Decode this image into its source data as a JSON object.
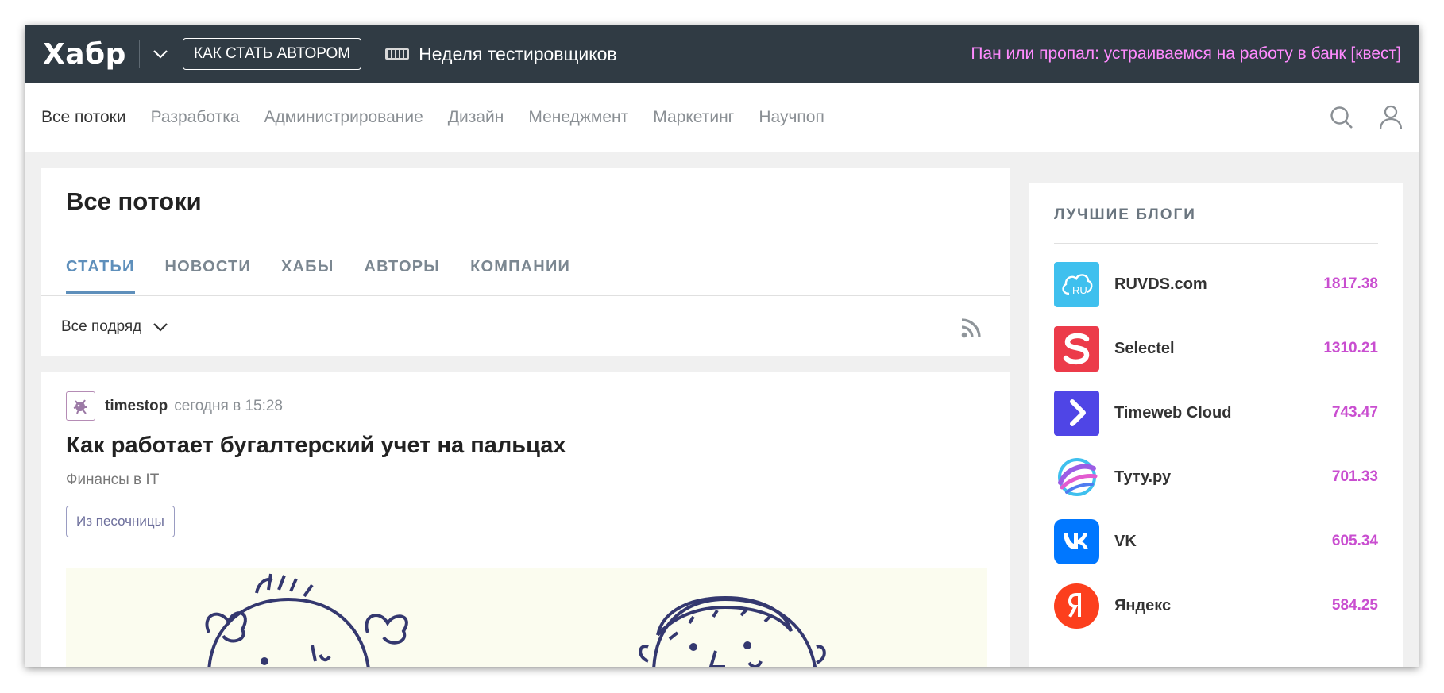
{
  "topbar": {
    "logo": "Хабр",
    "author_button": "КАК СТАТЬ АВТОРОМ",
    "promo": "Неделя тестировщиков",
    "quest_link": "Пан или пропал: устраиваемся на работу в банк [квест]"
  },
  "nav": {
    "items": [
      "Все потоки",
      "Разработка",
      "Администрирование",
      "Дизайн",
      "Менеджмент",
      "Маркетинг",
      "Научпоп"
    ],
    "active": "Все потоки",
    "icons": [
      "search-icon",
      "user-icon"
    ]
  },
  "feed": {
    "title": "Все потоки",
    "tabs": [
      "СТАТЬИ",
      "НОВОСТИ",
      "ХАБЫ",
      "АВТОРЫ",
      "КОМПАНИИ"
    ],
    "active_tab": "СТАТЬИ",
    "filter": "Все подряд"
  },
  "article": {
    "author": "timestop",
    "time": "сегодня в 15:28",
    "title": "Как работает бугалтерский учет на пальцах",
    "hub": "Финансы в IT",
    "badge": "Из песочницы"
  },
  "sidebar": {
    "title": "ЛУЧШИЕ БЛОГИ",
    "blogs": [
      {
        "name": "RUVDS.com",
        "rating": "1817.38",
        "color": "#3fc0ee"
      },
      {
        "name": "Selectel",
        "rating": "1310.21",
        "color": "#ec3b4a"
      },
      {
        "name": "Timeweb Cloud",
        "rating": "743.47",
        "color": "#4f45e6"
      },
      {
        "name": "Туту.ру",
        "rating": "701.33",
        "color": "#9b5de5"
      },
      {
        "name": "VK",
        "rating": "605.34",
        "color": "#0077ff"
      },
      {
        "name": "Яндекс",
        "rating": "584.25",
        "color": "#fc3f1d"
      }
    ]
  },
  "colors": {
    "topbar_bg": "#303b44",
    "quest": "#ff8bff",
    "tab_active": "#5e8fbb",
    "rating": "#c94ed0"
  }
}
